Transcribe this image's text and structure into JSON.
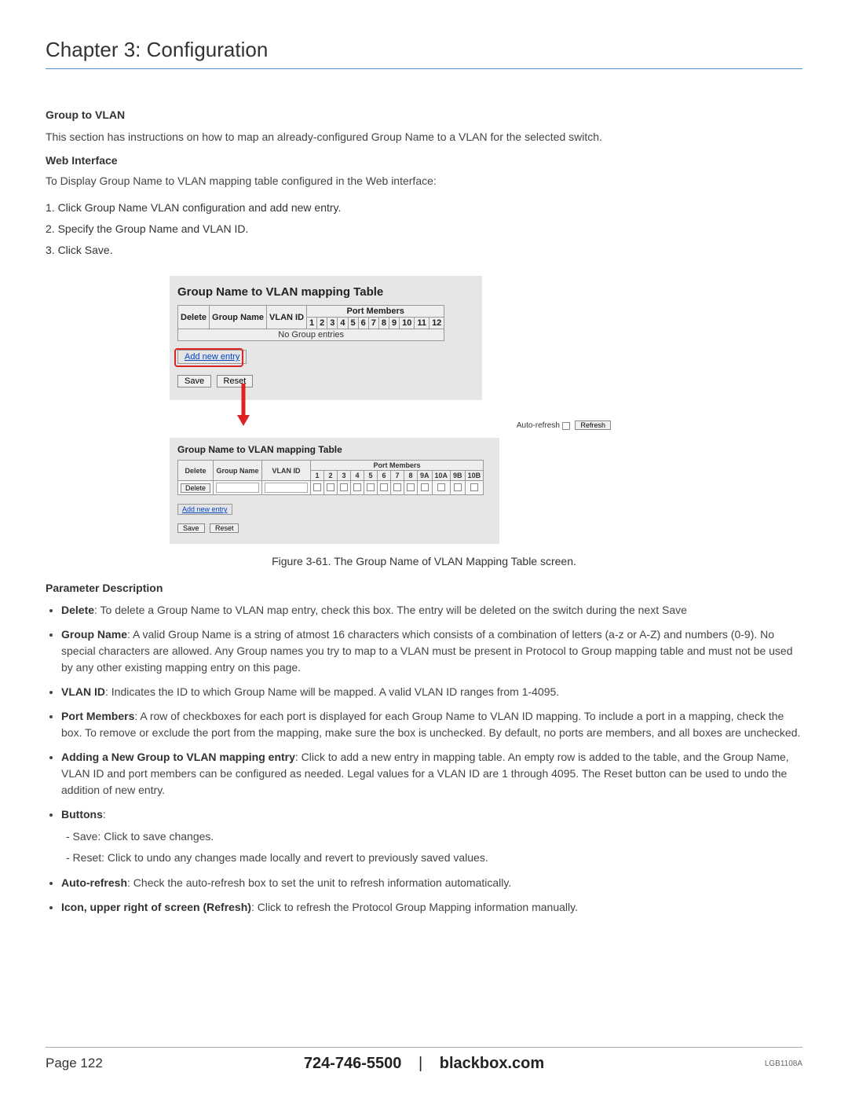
{
  "chapter_title": "Chapter 3: Configuration",
  "section": {
    "title": "Group to VLAN",
    "intro": "This section has instructions on how to map an already-configured Group Name to a VLAN for the selected switch.",
    "web_heading": "Web Interface",
    "web_intro": "To Display Group Name to VLAN mapping table configured in the Web interface:",
    "steps": [
      "1. Click Group Name VLAN configuration and add new entry.",
      "2. Specify the Group Name and VLAN ID.",
      "3. Click Save."
    ]
  },
  "figure1": {
    "title": "Group Name to VLAN mapping Table",
    "cols": {
      "delete": "Delete",
      "group_name": "Group Name",
      "vlan_id": "VLAN ID",
      "port_members": "Port Members",
      "ports": [
        "1",
        "2",
        "3",
        "4",
        "5",
        "6",
        "7",
        "8",
        "9",
        "10",
        "11",
        "12"
      ]
    },
    "no_entries": "No Group entries",
    "add_new": "Add new entry",
    "save": "Save",
    "reset": "Reset"
  },
  "figure2": {
    "title": "Group Name to VLAN mapping Table",
    "auto_refresh": "Auto-refresh",
    "refresh": "Refresh",
    "cols": {
      "delete": "Delete",
      "group_name": "Group Name",
      "vlan_id": "VLAN ID",
      "port_members": "Port Members",
      "ports": [
        "1",
        "2",
        "3",
        "4",
        "5",
        "6",
        "7",
        "8",
        "9A",
        "10A",
        "9B",
        "10B"
      ]
    },
    "delete_btn": "Delete",
    "add_new": "Add new entry",
    "save": "Save",
    "reset": "Reset"
  },
  "caption": "Figure 3-61. The Group Name of VLAN Mapping Table screen.",
  "param_heading": "Parameter Description",
  "params": {
    "delete": {
      "term": "Delete",
      "desc": ": To delete a Group Name to VLAN map entry, check this box. The entry will be deleted on the switch during the next Save"
    },
    "group_name": {
      "term": "Group Name",
      "desc": ": A valid Group Name is a string of atmost 16 characters which consists of a combination of letters (a-z or A-Z) and numbers (0-9). No special characters are allowed. Any Group names you try to map to a VLAN must be present in Protocol to Group mapping table and must not be used by any other existing mapping entry on this page."
    },
    "vlan_id": {
      "term": "VLAN ID",
      "desc": ": Indicates the ID to which Group Name will be mapped. A valid VLAN ID ranges from 1-4095."
    },
    "port_members": {
      "term": "Port Members",
      "desc": ": A row of checkboxes for each port is displayed for each Group Name to VLAN ID mapping. To include a port in a mapping, check the box. To remove or exclude the port from the mapping, make sure the box is unchecked. By default, no ports are members, and all boxes are unchecked."
    },
    "adding": {
      "term": "Adding a New Group to VLAN mapping entry",
      "desc": ": Click to add a new entry in mapping table. An empty row is added to the table, and the Group Name, VLAN ID and port members can be configured as needed. Legal values for a VLAN ID are 1 through 4095. The Reset button can be used to undo the addition of new entry."
    },
    "buttons": {
      "term": "Buttons",
      "desc": ":"
    },
    "save_sub": "- Save: Click to save changes.",
    "reset_sub": "- Reset: Click to undo any changes made locally and revert to previously saved values.",
    "auto_refresh": {
      "term": "Auto-refresh",
      "desc": ": Check the auto-refresh box to set the unit to refresh information automatically."
    },
    "icon_refresh": {
      "term": "Icon, upper right of screen (Refresh)",
      "desc": ": Click to refresh the Protocol Group Mapping information manually."
    }
  },
  "footer": {
    "page": "Page 122",
    "phone": "724-746-5500",
    "site": "blackbox.com",
    "model": "LGB1108A"
  }
}
